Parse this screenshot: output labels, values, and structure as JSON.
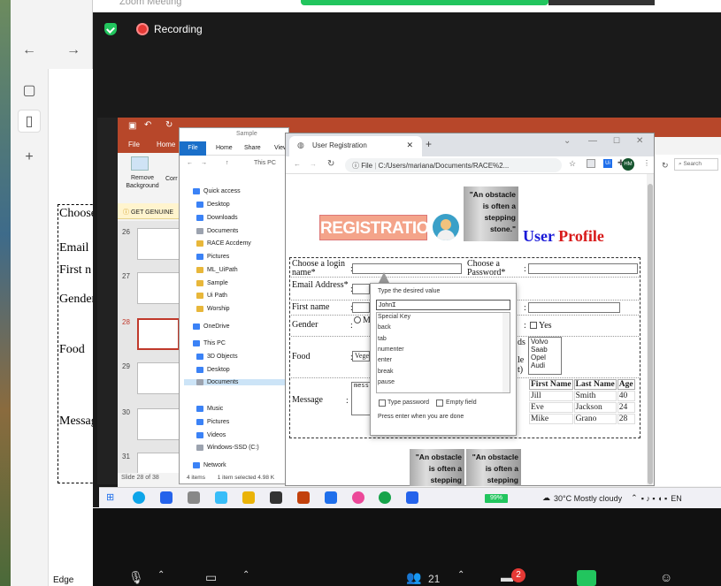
{
  "zoom": {
    "title": "Zoom Meeting",
    "recording_label": "Recording",
    "participants_count": "21",
    "chat_badge": "2",
    "bottom_left_label": "Edge"
  },
  "bg_doc": {
    "lines": [
      "Choose a login name*",
      "Email",
      "First n",
      "Gender",
      "Food",
      "Message"
    ]
  },
  "powerpoint": {
    "tabs": [
      "File",
      "Home"
    ],
    "ribbon_button": "Remove Background",
    "ribbon_button_2": "Corr",
    "banner": "GET GENUINE",
    "slide_numbers": [
      "26",
      "27",
      "28",
      "29",
      "30",
      "31"
    ],
    "status": "Slide 28 of 38"
  },
  "explorer": {
    "title": "Sample",
    "tabs": [
      "File",
      "Home",
      "Share",
      "View"
    ],
    "path": "This PC",
    "items": [
      "Quick access",
      "Desktop",
      "Downloads",
      "Documents",
      "RACE Accdemy",
      "Pictures",
      "ML_UiPath",
      "Sample",
      "Ui Path",
      "Worship",
      "OneDrive",
      "This PC",
      "3D Objects",
      "Desktop",
      "Documents",
      "Music",
      "Pictures",
      "Videos",
      "Windows-SSD (C:)",
      "Network"
    ],
    "status_items": "4 items",
    "status_selected": "1 item selected  4.98 K"
  },
  "chrome": {
    "tab_title": "User Registration",
    "url_prefix": "File",
    "url": "C:/Users/mariana/Documents/RACE%2...",
    "profile_initials": "HM",
    "search_placeholder": "Search"
  },
  "page": {
    "logo_text": "REGISTRATION",
    "quote": "\"An obstacle is often a stepping stone.\"",
    "heading_user": "User",
    "heading_profile": "Profile",
    "labels": {
      "login": "Choose a login name*",
      "password": "Choose a Password*",
      "email": "Email Address*",
      "first_name": "First name",
      "gender": "Gender",
      "food": "Food",
      "message": "Message"
    },
    "gender_option": "M",
    "yes_label": "Yes",
    "food_value": "Vege",
    "message_value": "mess",
    "cars": [
      "Volvo",
      "Saab",
      "Opel",
      "Audi"
    ],
    "table": {
      "headers": [
        "First Name",
        "Last Name",
        "Age"
      ],
      "rows": [
        [
          "Jill",
          "Smith",
          "40"
        ],
        [
          "Eve",
          "Jackson",
          "24"
        ],
        [
          "Mike",
          "Grano",
          "28"
        ]
      ]
    },
    "partial_text": [
      "ds",
      "le",
      "t)"
    ]
  },
  "popup": {
    "title": "Type the desired value",
    "value": "John",
    "options": [
      "Special Key",
      "back",
      "tab",
      "numenter",
      "enter",
      "break",
      "pause"
    ],
    "type_password_label": "Type password",
    "empty_field_label": "Empty field",
    "hint": "Press enter when you are done"
  },
  "taskbar": {
    "battery": "99%",
    "weather": "30°C  Mostly cloudy",
    "lang": "EN"
  }
}
